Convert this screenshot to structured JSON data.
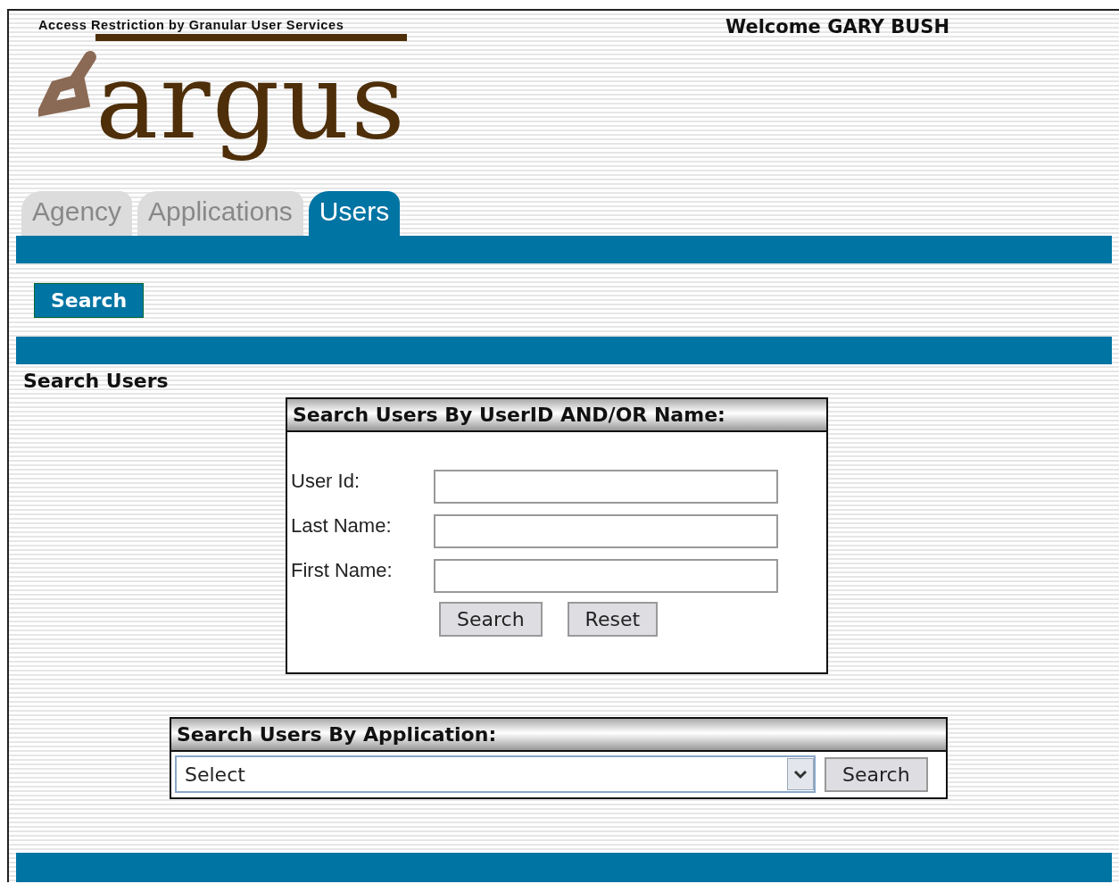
{
  "header": {
    "tagline": "Access Restriction by Granular User Services",
    "logo": "argus",
    "welcome": "Welcome GARY BUSH"
  },
  "tabs": [
    {
      "label": "Agency",
      "selected": false
    },
    {
      "label": "Applications",
      "selected": false
    },
    {
      "label": "Users",
      "selected": true
    }
  ],
  "subnav": [
    {
      "label": "Search",
      "selected": true
    }
  ],
  "page_title": "Search Users",
  "name_search": {
    "title": "Search Users By UserID AND/OR Name:",
    "fields": [
      {
        "label": "User Id:"
      },
      {
        "label": "Last Name:"
      },
      {
        "label": "First Name:"
      }
    ],
    "buttons": [
      "Search",
      "Reset"
    ]
  },
  "app_search": {
    "title": "Search Users By Application:",
    "select": {
      "value": "Select"
    },
    "button": "Search"
  }
}
